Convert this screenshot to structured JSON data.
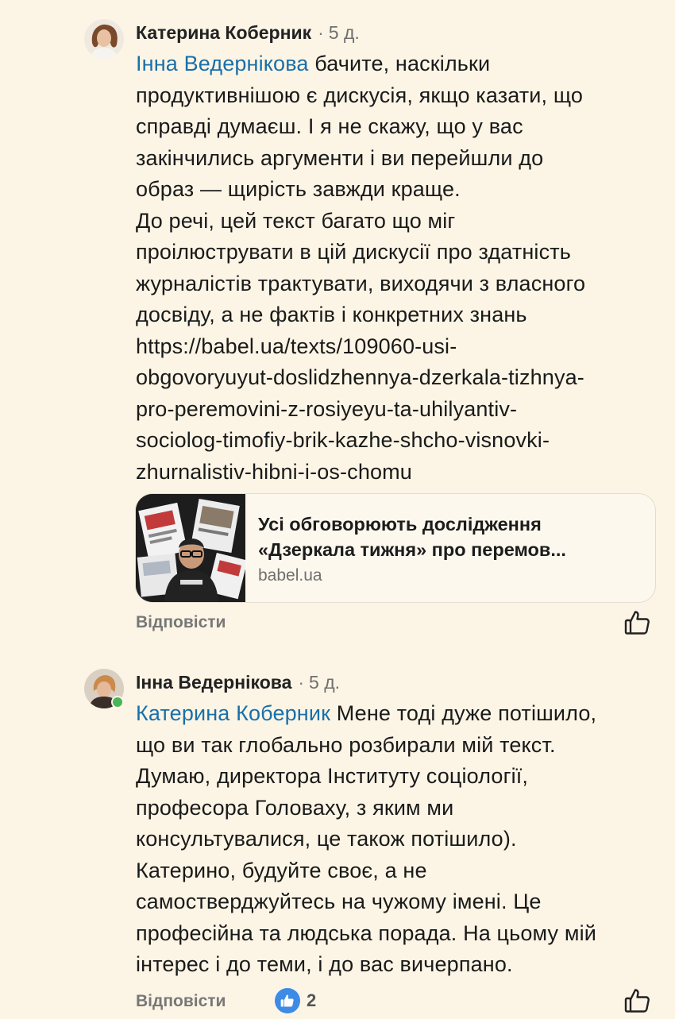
{
  "comments": [
    {
      "author": "Катерина Коберник",
      "time": "5 д.",
      "mention": "Інна Ведернікова",
      "lines": [
        "бачите, наскільки",
        "продуктивнішою є дискусія, якщо казати, що",
        "справді думаєш. І я не скажу, що у вас",
        "закінчились аргументи і ви перейшли до",
        "образ — щирість завжди краще.",
        "До речі, цей текст багато що міг",
        "проілюструвати в цій дискусії про здатність",
        "журналістів трактувати, виходячи з власного",
        "досвіду, а не фактів і конкретних знань",
        "https://babel.ua/texts/109060-usi-",
        "obgovoryuyut-doslidzhennya-dzerkala-tizhnya-",
        "pro-peremovini-z-rosiyeyu-ta-uhilyantiv-",
        "sociolog-timofiy-brik-kazhe-shcho-visnovki-",
        "zhurnalistiv-hibni-i-os-chomu"
      ],
      "link_preview": {
        "title_line1": "Усі обговорюють дослідження",
        "title_line2": "«Дзеркала тижня» про перемов...",
        "domain": "babel.ua"
      },
      "reply_label": "Відповісти",
      "like_icon": "thumbs-up-outline-icon"
    },
    {
      "author": "Інна Ведернікова",
      "time": "5 д.",
      "mention": "Катерина Коберник",
      "lines": [
        "Мене тоді дуже потішило,",
        "що ви так глобально розбирали мій текст.",
        "Думаю, директора Інституту соціології,",
        "професора Головаху, з яким ми",
        "консультувалися, це також потішило).",
        "Катерино, будуйте своє, а не",
        "самостверджуйтесь на чужому імені. Це",
        "професійна та людська порада. На цьому мій",
        "інтерес і до теми, і до вас вичерпано."
      ],
      "reply_label": "Відповісти",
      "reaction_count": "2",
      "like_icon": "thumbs-up-outline-icon"
    }
  ],
  "colors": {
    "background": "#fcf5e6",
    "mention": "#1a6fa8",
    "reaction": "#3d8be6",
    "online": "#48b55a"
  }
}
